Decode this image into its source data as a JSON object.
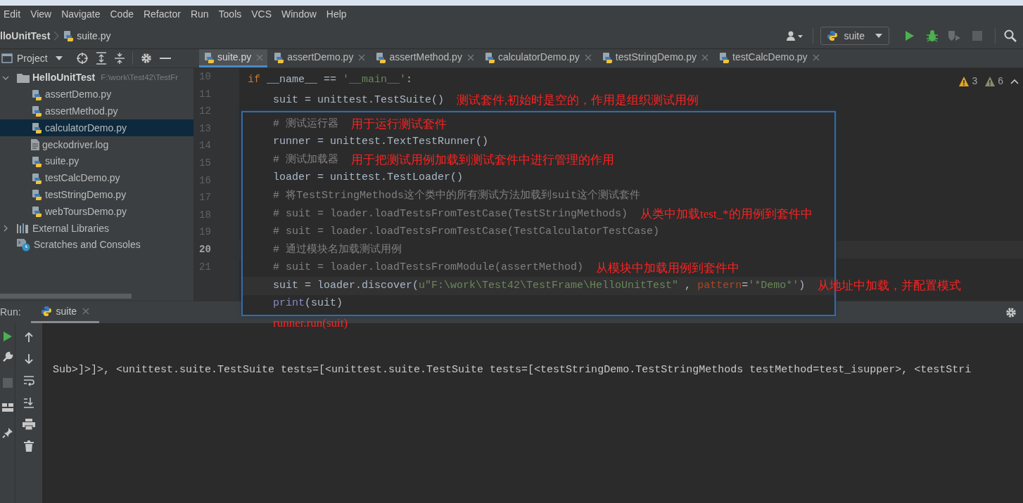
{
  "menu": [
    "Edit",
    "View",
    "Navigate",
    "Code",
    "Refactor",
    "Run",
    "Tools",
    "VCS",
    "Window",
    "Help"
  ],
  "breadcrumb": {
    "project": "lloUnitTest",
    "file": "suite.py"
  },
  "run_config": "suite",
  "project_panel": {
    "title": "Project",
    "tree": [
      {
        "label": "HelloUnitTest",
        "kind": "folder",
        "path": "F:\\work\\Test42\\TestFr",
        "expanded": true,
        "selected": false,
        "children": [
          {
            "label": "assertDemo.py",
            "kind": "python",
            "selected": false
          },
          {
            "label": "assertMethod.py",
            "kind": "python",
            "selected": false
          },
          {
            "label": "calculatorDemo.py",
            "kind": "python",
            "selected": true
          },
          {
            "label": "geckodriver.log",
            "kind": "log",
            "selected": false
          },
          {
            "label": "suite.py",
            "kind": "python",
            "selected": false
          },
          {
            "label": "testCalcDemo.py",
            "kind": "python",
            "selected": false
          },
          {
            "label": "testStringDemo.py",
            "kind": "python",
            "selected": false
          },
          {
            "label": "webToursDemo.py",
            "kind": "python",
            "selected": false
          }
        ]
      },
      {
        "label": "External Libraries",
        "kind": "library",
        "expanded": false,
        "selected": false
      },
      {
        "label": "Scratches and Consoles",
        "kind": "scratches",
        "selected": false
      }
    ]
  },
  "tabs": [
    {
      "label": "suite.py",
      "selected": true
    },
    {
      "label": "assertDemo.py",
      "selected": false
    },
    {
      "label": "assertMethod.py",
      "selected": false
    },
    {
      "label": "calculatorDemo.py",
      "selected": false
    },
    {
      "label": "testStringDemo.py",
      "selected": false
    },
    {
      "label": "testCalcDemo.py",
      "selected": false
    }
  ],
  "inspections": [
    {
      "kind": "error",
      "count": "3"
    },
    {
      "kind": "warning",
      "count": "6"
    }
  ],
  "gutter": [
    {
      "number": "10",
      "current": false
    },
    {
      "number": "11",
      "current": false
    },
    {
      "number": "12",
      "current": false
    },
    {
      "number": "13",
      "current": false
    },
    {
      "number": "14",
      "current": false
    },
    {
      "number": "15",
      "current": false
    },
    {
      "number": "16",
      "current": false
    },
    {
      "number": "17",
      "current": false
    },
    {
      "number": "18",
      "current": false
    },
    {
      "number": "19",
      "current": false
    },
    {
      "number": "20",
      "current": true
    },
    {
      "number": "21",
      "current": false
    }
  ],
  "popup": {
    "header_lines": [
      {
        "tokens": [
          {
            "kind": "keyword",
            "text": "if"
          },
          {
            "kind": "plain",
            "text": " __name__ == "
          },
          {
            "kind": "string",
            "text": "'__main__'"
          },
          {
            "kind": "plain",
            "text": ":"
          }
        ],
        "current": false
      },
      {
        "tokens": [
          {
            "kind": "plain",
            "text": "    suit = unittest.TestSuite()"
          }
        ],
        "note": "测试套件,初始时是空的，作用是组织测试用例",
        "current": false
      }
    ],
    "lines": [
      {
        "tokens": [
          {
            "kind": "comment",
            "text": "# 测试运行器"
          }
        ],
        "note": "用于运行测试套件",
        "current": false
      },
      {
        "tokens": [
          {
            "kind": "plain",
            "text": "runner = unittest.TextTestRunner()"
          }
        ],
        "current": false
      },
      {
        "tokens": [
          {
            "kind": "comment",
            "text": "# 测试加载器"
          }
        ],
        "note": "用于把测试用例加载到测试套件中进行管理的作用",
        "current": false
      },
      {
        "tokens": [
          {
            "kind": "plain",
            "text": "loader = unittest.TestLoader()"
          }
        ],
        "current": false
      },
      {
        "tokens": [
          {
            "kind": "comment",
            "text": "# 将TestStringMethods这个类中的所有测试方法加载到suit这个测试套件"
          }
        ],
        "current": false
      },
      {
        "tokens": [
          {
            "kind": "comment",
            "text": "# suit = loader.loadTestsFromTestCase(TestStringMethods)"
          }
        ],
        "note": "从类中加载test_*的用例到套件中",
        "current": false
      },
      {
        "tokens": [
          {
            "kind": "comment",
            "text": "# suit = loader.loadTestsFromTestCase(TestCalculatorTestCase)"
          }
        ],
        "current": false
      },
      {
        "tokens": [
          {
            "kind": "comment",
            "text": "# 通过模块名加载测试用例"
          }
        ],
        "current": false
      },
      {
        "tokens": [
          {
            "kind": "comment",
            "text": "# suit = loader.loadTestsFromModule(assertMethod)"
          }
        ],
        "note": "从模块中加载用例到套件中",
        "current": false
      },
      {
        "tokens": [
          {
            "kind": "plain",
            "text": "suit = loader.discover("
          },
          {
            "kind": "string",
            "text": "u\"F:\\work\\Test42\\TestFrame\\HelloUnitTest\""
          },
          {
            "kind": "plain",
            "text": " , "
          },
          {
            "kind": "param",
            "text": "pattern"
          },
          {
            "kind": "plain",
            "text": "="
          },
          {
            "kind": "string",
            "text": "'*Demo*'"
          },
          {
            "kind": "plain",
            "text": ")"
          }
        ],
        "note": "从地址中加载，并配置模式",
        "current": true
      },
      {
        "tokens": [
          {
            "kind": "builtin",
            "text": "print"
          },
          {
            "kind": "plain",
            "text": "(suit)"
          }
        ],
        "current": false
      }
    ],
    "after_note": "runner.run(suit)"
  },
  "run_panel": {
    "title": "Run:",
    "tab": "suite",
    "output": "Sub>]>]>, <unittest.suite.TestSuite tests=[<unittest.suite.TestSuite tests=[<testStringDemo.TestStringMethods testMethod=test_isupper>, <testStri"
  }
}
